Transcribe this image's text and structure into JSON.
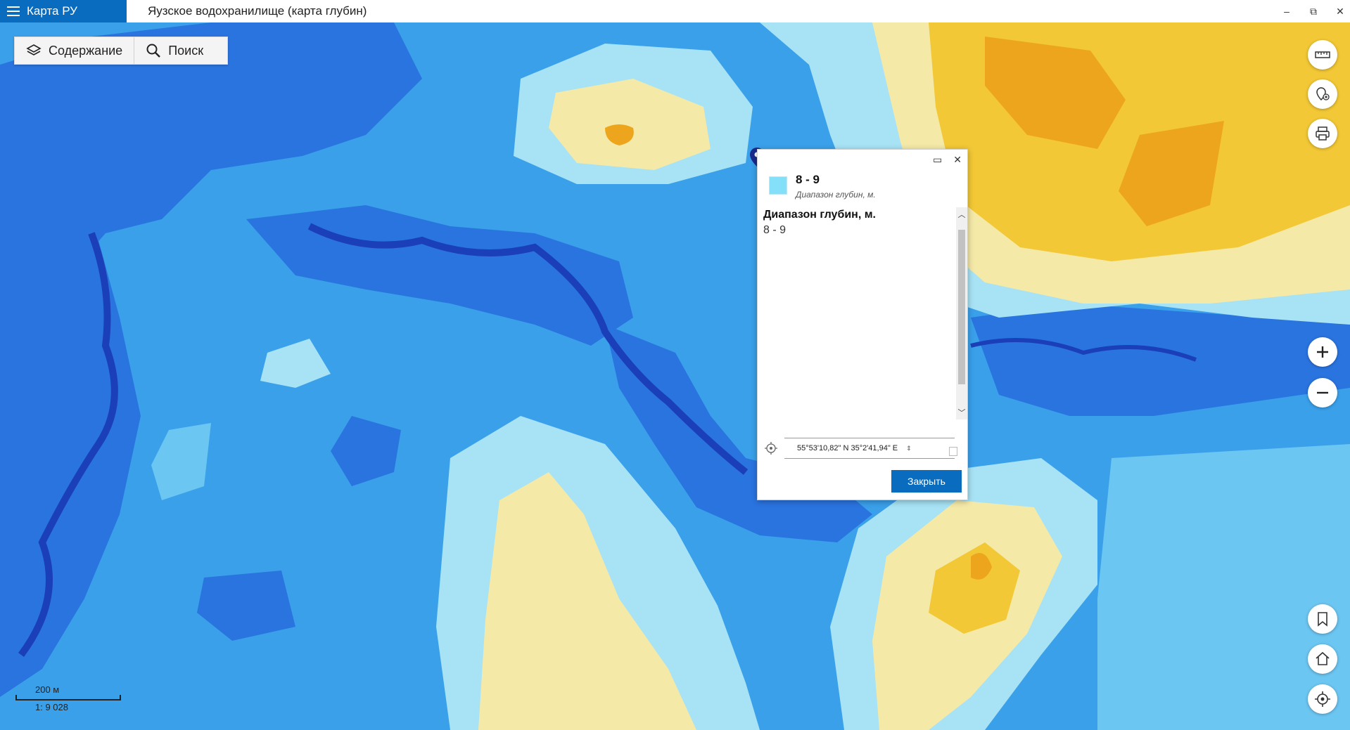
{
  "app": {
    "name": "Карта РУ",
    "window_title": "Яузское водохранилище (карта глубин)"
  },
  "window_controls": {
    "minimize": "–",
    "restore": "⧉",
    "close": "✕"
  },
  "toolbar": {
    "contents_label": "Содержание",
    "search_label": "Поиск"
  },
  "popup": {
    "title": "8 - 9",
    "subtitle": "Диапазон глубин, м.",
    "field_label": "Диапазон глубин, м.",
    "field_value": "8 - 9",
    "coordinates": "55°53'10,82\" N 35°2'41,94\" E",
    "close_label": "Закрыть",
    "swatch_color": "#84e0f8"
  },
  "scale": {
    "distance": "200 м",
    "ratio": "1: 9 028"
  },
  "icons": {
    "menu": "hamburger-icon",
    "contents": "layers-icon",
    "search": "search-icon",
    "ruler": "ruler-icon",
    "pin_add": "pin-add-icon",
    "print": "print-icon",
    "zoom_in": "plus-icon",
    "zoom_out": "minus-icon",
    "bookmark": "bookmark-icon",
    "home": "home-icon",
    "locate": "crosshair-icon",
    "marker": "map-pin-icon"
  },
  "colors": {
    "deep": "#1b4fd8",
    "mid_deep": "#2a74e0",
    "mid": "#3aa0ea",
    "shallow": "#6cc6f2",
    "very_shallow": "#a7e3f5",
    "sand": "#f5e9a8",
    "yellow": "#f2c836",
    "orange": "#eea51e",
    "accent": "#0a6cbf"
  }
}
